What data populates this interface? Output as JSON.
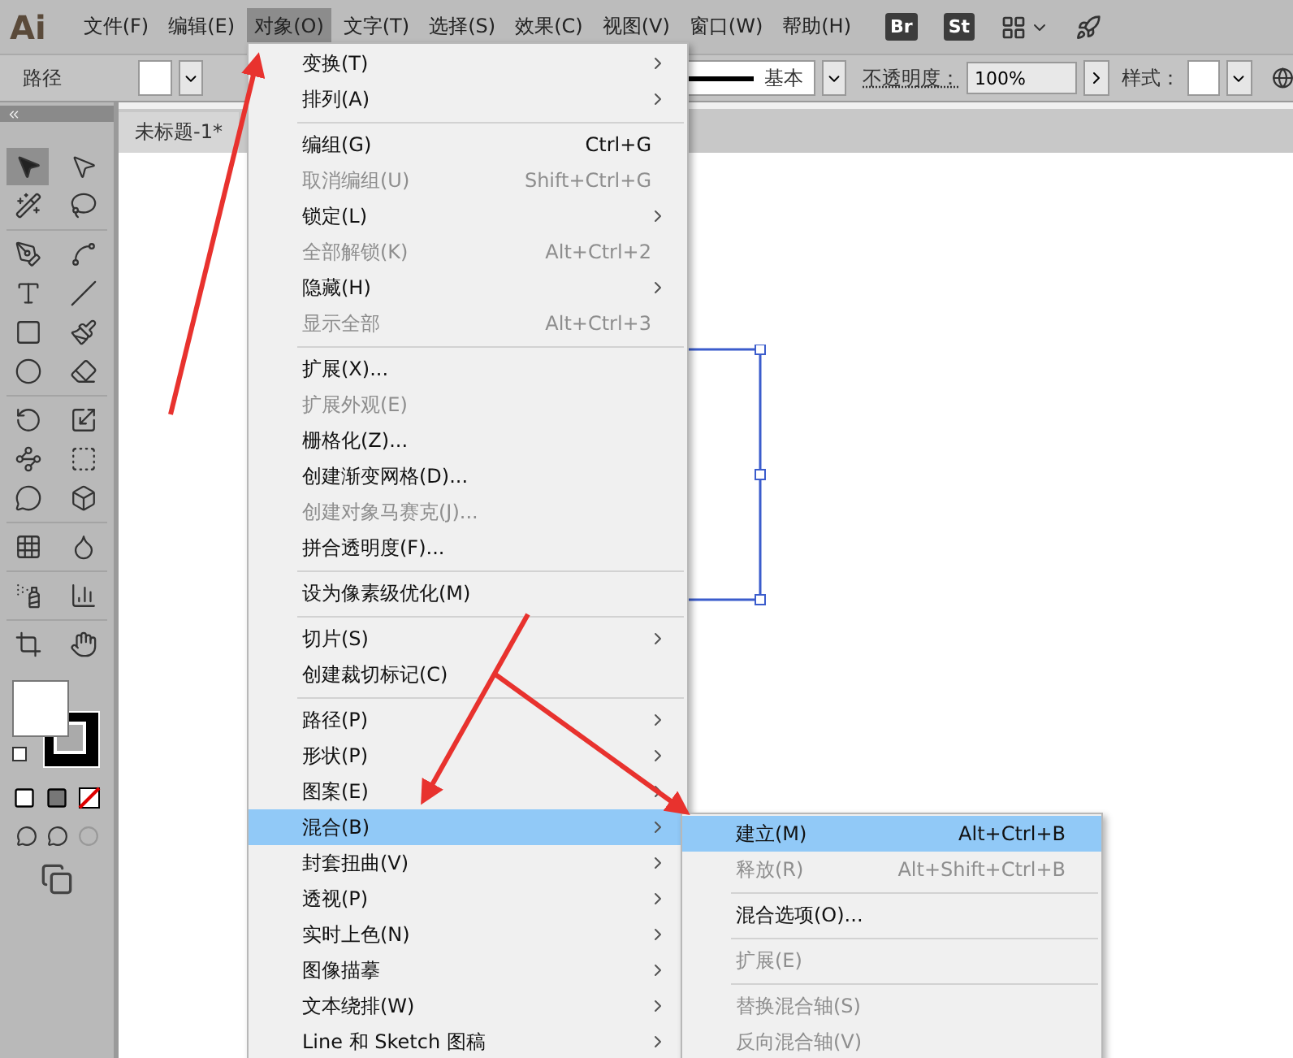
{
  "app_logo": "Ai",
  "menubar": [
    {
      "label": "文件(F)",
      "selected": false
    },
    {
      "label": "编辑(E)",
      "selected": false
    },
    {
      "label": "对象(O)",
      "selected": true
    },
    {
      "label": "文字(T)",
      "selected": false
    },
    {
      "label": "选择(S)",
      "selected": false
    },
    {
      "label": "效果(C)",
      "selected": false
    },
    {
      "label": "视图(V)",
      "selected": false
    },
    {
      "label": "窗口(W)",
      "selected": false
    },
    {
      "label": "帮助(H)",
      "selected": false
    }
  ],
  "app_buttons": [
    "Br",
    "St"
  ],
  "control_bar": {
    "object_type": "路径",
    "stroke_style": "基本",
    "opacity_label": "不透明度：",
    "opacity": "100%",
    "style_label": "样式："
  },
  "document_tab": {
    "title": "未标题-1*"
  },
  "tools": [
    {
      "selected": true
    },
    {
      "selected": false
    },
    {
      "selected": false
    },
    {
      "selected": false
    },
    {
      "selected": false
    },
    {
      "selected": false
    },
    {
      "selected": false
    },
    {
      "selected": false
    },
    {
      "selected": false
    },
    {
      "selected": false
    },
    {
      "selected": false
    },
    {
      "selected": false
    },
    {
      "selected": false
    },
    {
      "selected": false
    },
    {
      "selected": false
    },
    {
      "selected": false
    },
    {
      "selected": false
    },
    {
      "selected": false
    },
    {
      "selected": false
    },
    {
      "selected": false
    },
    {
      "selected": false
    },
    {
      "selected": false
    },
    {
      "selected": false
    },
    {
      "selected": false
    }
  ],
  "object_menu": [
    {
      "kind": "item",
      "label": "变换(T)",
      "submenu": true,
      "disabled": false,
      "selected": false
    },
    {
      "kind": "item",
      "label": "排列(A)",
      "submenu": true,
      "disabled": false,
      "selected": false
    },
    {
      "kind": "separator"
    },
    {
      "kind": "item",
      "label": "编组(G)",
      "shortcut": "Ctrl+G",
      "submenu": false,
      "disabled": false,
      "selected": false
    },
    {
      "kind": "item",
      "label": "取消编组(U)",
      "shortcut": "Shift+Ctrl+G",
      "submenu": false,
      "disabled": true,
      "selected": false
    },
    {
      "kind": "item",
      "label": "锁定(L)",
      "submenu": true,
      "disabled": false,
      "selected": false
    },
    {
      "kind": "item",
      "label": "全部解锁(K)",
      "shortcut": "Alt+Ctrl+2",
      "submenu": false,
      "disabled": true,
      "selected": false
    },
    {
      "kind": "item",
      "label": "隐藏(H)",
      "submenu": true,
      "disabled": false,
      "selected": false
    },
    {
      "kind": "item",
      "label": "显示全部",
      "shortcut": "Alt+Ctrl+3",
      "submenu": false,
      "disabled": true,
      "selected": false
    },
    {
      "kind": "separator"
    },
    {
      "kind": "item",
      "label": "扩展(X)...",
      "submenu": false,
      "disabled": false,
      "selected": false
    },
    {
      "kind": "item",
      "label": "扩展外观(E)",
      "submenu": false,
      "disabled": true,
      "selected": false
    },
    {
      "kind": "item",
      "label": "栅格化(Z)...",
      "submenu": false,
      "disabled": false,
      "selected": false
    },
    {
      "kind": "item",
      "label": "创建渐变网格(D)...",
      "submenu": false,
      "disabled": false,
      "selected": false
    },
    {
      "kind": "item",
      "label": "创建对象马赛克(J)...",
      "submenu": false,
      "disabled": true,
      "selected": false
    },
    {
      "kind": "item",
      "label": "拼合透明度(F)...",
      "submenu": false,
      "disabled": false,
      "selected": false
    },
    {
      "kind": "separator"
    },
    {
      "kind": "item",
      "label": "设为像素级优化(M)",
      "submenu": false,
      "disabled": false,
      "selected": false
    },
    {
      "kind": "separator"
    },
    {
      "kind": "item",
      "label": "切片(S)",
      "submenu": true,
      "disabled": false,
      "selected": false
    },
    {
      "kind": "item",
      "label": "创建裁切标记(C)",
      "submenu": false,
      "disabled": false,
      "selected": false
    },
    {
      "kind": "separator"
    },
    {
      "kind": "item",
      "label": "路径(P)",
      "submenu": true,
      "disabled": false,
      "selected": false
    },
    {
      "kind": "item",
      "label": "形状(P)",
      "submenu": true,
      "disabled": false,
      "selected": false
    },
    {
      "kind": "item",
      "label": "图案(E)",
      "submenu": true,
      "disabled": false,
      "selected": false
    },
    {
      "kind": "item",
      "label": "混合(B)",
      "submenu": true,
      "disabled": false,
      "selected": true
    },
    {
      "kind": "item",
      "label": "封套扭曲(V)",
      "submenu": true,
      "disabled": false,
      "selected": false
    },
    {
      "kind": "item",
      "label": "透视(P)",
      "submenu": true,
      "disabled": false,
      "selected": false
    },
    {
      "kind": "item",
      "label": "实时上色(N)",
      "submenu": true,
      "disabled": false,
      "selected": false
    },
    {
      "kind": "item",
      "label": "图像描摹",
      "submenu": true,
      "disabled": false,
      "selected": false
    },
    {
      "kind": "item",
      "label": "文本绕排(W)",
      "submenu": true,
      "disabled": false,
      "selected": false
    },
    {
      "kind": "item",
      "label": "Line 和 Sketch 图稿",
      "submenu": true,
      "disabled": false,
      "selected": false
    }
  ],
  "blend_submenu": [
    {
      "kind": "item",
      "label": "建立(M)",
      "shortcut": "Alt+Ctrl+B",
      "submenu": false,
      "disabled": false,
      "selected": true
    },
    {
      "kind": "item",
      "label": "释放(R)",
      "shortcut": "Alt+Shift+Ctrl+B",
      "submenu": false,
      "disabled": true,
      "selected": false
    },
    {
      "kind": "separator"
    },
    {
      "kind": "item",
      "label": "混合选项(O)...",
      "submenu": false,
      "disabled": false,
      "selected": false
    },
    {
      "kind": "separator"
    },
    {
      "kind": "item",
      "label": "扩展(E)",
      "submenu": false,
      "disabled": true,
      "selected": false
    },
    {
      "kind": "separator"
    },
    {
      "kind": "item",
      "label": "替换混合轴(S)",
      "submenu": false,
      "disabled": true,
      "selected": false
    },
    {
      "kind": "item",
      "label": "反向混合轴(V)",
      "submenu": false,
      "disabled": true,
      "selected": false
    }
  ]
}
